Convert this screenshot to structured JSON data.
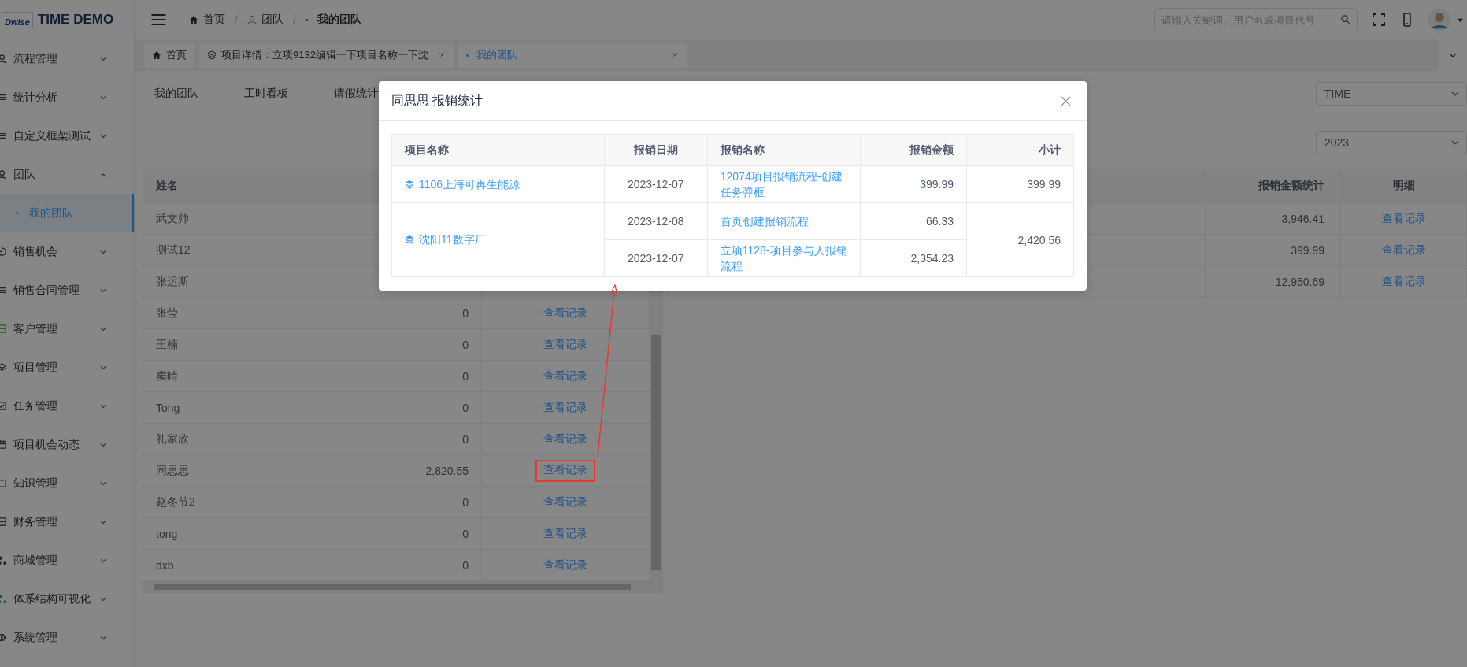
{
  "app": {
    "logo": "Dwise",
    "title": "TIME DEMO"
  },
  "sidebar": {
    "items": [
      {
        "label": "流程管理",
        "expanded": false
      },
      {
        "label": "统计分析",
        "expanded": false
      },
      {
        "label": "自定义框架测试",
        "expanded": false
      },
      {
        "label": "团队",
        "expanded": true,
        "children": [
          {
            "label": "我的团队",
            "selected": true
          }
        ]
      },
      {
        "label": "销售机会",
        "expanded": false
      },
      {
        "label": "销售合同管理",
        "expanded": false
      },
      {
        "label": "客户管理",
        "expanded": false
      },
      {
        "label": "项目管理",
        "expanded": false
      },
      {
        "label": "任务管理",
        "expanded": false
      },
      {
        "label": "项目机会动态",
        "expanded": false
      },
      {
        "label": "知识管理",
        "expanded": false
      },
      {
        "label": "财务管理",
        "expanded": false
      },
      {
        "label": "商城管理",
        "expanded": false
      },
      {
        "label": "体系结构可视化",
        "expanded": false
      },
      {
        "label": "系统管理",
        "expanded": false
      }
    ]
  },
  "header": {
    "breadcrumb": [
      "首页",
      "团队",
      "我的团队"
    ],
    "separator": "/",
    "search": {
      "placeholder": "请输入关键词、用户名或项目代号"
    }
  },
  "tags": [
    {
      "label": "首页",
      "closable": false,
      "selected": false
    },
    {
      "label": "项目详情：立项9132编辑一下项目名称一下沈",
      "closable": true,
      "selected": false
    },
    {
      "label": "我的团队",
      "closable": true,
      "selected": true
    }
  ],
  "subtabs": [
    "我的团队",
    "工时看板",
    "请假统计"
  ],
  "filters": {
    "group": "TIME",
    "year": "2023"
  },
  "team_table": {
    "columns": [
      "姓名"
    ],
    "rows": [
      {
        "name": "武文帅",
        "annotated": false
      },
      {
        "name": "测试12",
        "annotated": false
      },
      {
        "name": "张运斯",
        "annotated": false
      },
      {
        "name": "张莹",
        "amount": "0",
        "link": "查看记录",
        "annotated": false
      },
      {
        "name": "王楠",
        "amount": "0",
        "link": "查看记录",
        "annotated": false
      },
      {
        "name": "窦晴",
        "amount": "0",
        "link": "查看记录",
        "annotated": false
      },
      {
        "name": "Tong",
        "amount": "0",
        "link": "查看记录",
        "annotated": false
      },
      {
        "name": "礼家欣",
        "amount": "0",
        "link": "查看记录",
        "annotated": false
      },
      {
        "name": "同思思",
        "amount": "2,820.55",
        "link": "查看记录",
        "annotated": true
      },
      {
        "name": "赵冬节2",
        "amount": "0",
        "link": "查看记录",
        "annotated": false
      },
      {
        "name": "tong",
        "amount": "0",
        "link": "查看记录",
        "annotated": false
      },
      {
        "name": "dxb",
        "amount": "0",
        "link": "查看记录",
        "annotated": false
      }
    ]
  },
  "summary_table": {
    "columns": [
      "报销金额统计",
      "明细"
    ],
    "rows": [
      {
        "amount": "3,946.41",
        "link": "查看记录"
      },
      {
        "amount": "399.99",
        "link": "查看记录"
      },
      {
        "amount": "12,950.69",
        "link": "查看记录"
      }
    ]
  },
  "dialog": {
    "title": "同思思 报销统计",
    "columns": [
      "项目名称",
      "报销日期",
      "报销名称",
      "报销金额",
      "小计"
    ],
    "projects": [
      {
        "name": "1106上海可再生能源",
        "subtotal": "399.99",
        "entries": [
          {
            "date": "2023-12-07",
            "title": "12074项目报销流程-创建任务弹框",
            "amount": "399.99"
          }
        ]
      },
      {
        "name": "沈阳11数字厂",
        "subtotal": "2,420.56",
        "entries": [
          {
            "date": "2023-12-08",
            "title": "首页创建报销流程",
            "amount": "66.33"
          },
          {
            "date": "2023-12-07",
            "title": "立项1128-项目参与人报销流程",
            "amount": "2,354.23"
          }
        ]
      }
    ]
  }
}
